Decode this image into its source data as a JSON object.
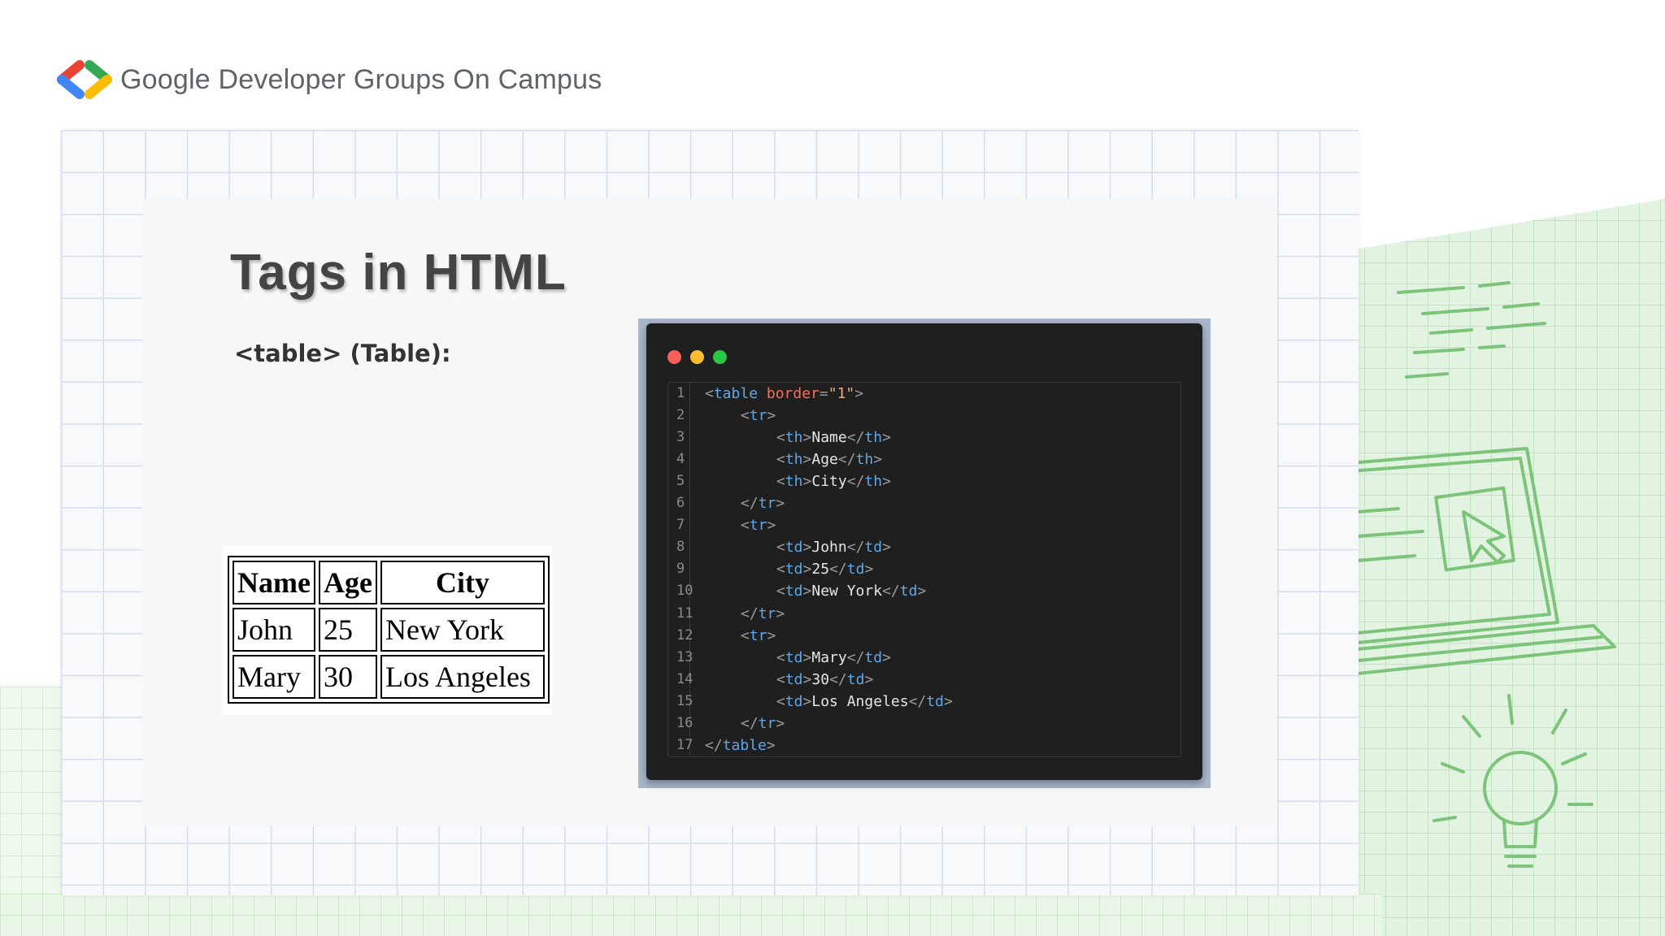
{
  "header": {
    "brand_text": "Google Developer Groups On Campus",
    "logo_colors": [
      "#ea4335",
      "#4285f4",
      "#34a853",
      "#fbbc04"
    ]
  },
  "slide": {
    "title": "Tags in HTML",
    "subtitle": "<table> (Table):"
  },
  "rendered_table": {
    "headers": [
      "Name",
      "Age",
      "City"
    ],
    "rows": [
      [
        "John",
        "25",
        "New York"
      ],
      [
        "Mary",
        "30",
        "Los Angeles"
      ]
    ]
  },
  "code_editor": {
    "window_dots": [
      "#ff5f57",
      "#febc2e",
      "#28c840"
    ],
    "lines": [
      {
        "n": "1",
        "indent": 0,
        "tokens": [
          [
            "p",
            "<"
          ],
          [
            "t",
            "table"
          ],
          [
            "s",
            " "
          ],
          [
            "a",
            "border"
          ],
          [
            "p",
            "="
          ],
          [
            "v",
            "\"1\""
          ],
          [
            "p",
            ">"
          ]
        ]
      },
      {
        "n": "2",
        "indent": 1,
        "tokens": [
          [
            "p",
            "<"
          ],
          [
            "t",
            "tr"
          ],
          [
            "p",
            ">"
          ]
        ]
      },
      {
        "n": "3",
        "indent": 2,
        "tokens": [
          [
            "p",
            "<"
          ],
          [
            "t",
            "th"
          ],
          [
            "p",
            ">"
          ],
          [
            "x",
            "Name"
          ],
          [
            "p",
            "</"
          ],
          [
            "t",
            "th"
          ],
          [
            "p",
            ">"
          ]
        ]
      },
      {
        "n": "4",
        "indent": 2,
        "tokens": [
          [
            "p",
            "<"
          ],
          [
            "t",
            "th"
          ],
          [
            "p",
            ">"
          ],
          [
            "x",
            "Age"
          ],
          [
            "p",
            "</"
          ],
          [
            "t",
            "th"
          ],
          [
            "p",
            ">"
          ]
        ]
      },
      {
        "n": "5",
        "indent": 2,
        "tokens": [
          [
            "p",
            "<"
          ],
          [
            "t",
            "th"
          ],
          [
            "p",
            ">"
          ],
          [
            "x",
            "City"
          ],
          [
            "p",
            "</"
          ],
          [
            "t",
            "th"
          ],
          [
            "p",
            ">"
          ]
        ]
      },
      {
        "n": "6",
        "indent": 1,
        "tokens": [
          [
            "p",
            "</"
          ],
          [
            "t",
            "tr"
          ],
          [
            "p",
            ">"
          ]
        ]
      },
      {
        "n": "7",
        "indent": 1,
        "tokens": [
          [
            "p",
            "<"
          ],
          [
            "t",
            "tr"
          ],
          [
            "p",
            ">"
          ]
        ]
      },
      {
        "n": "8",
        "indent": 2,
        "tokens": [
          [
            "p",
            "<"
          ],
          [
            "t",
            "td"
          ],
          [
            "p",
            ">"
          ],
          [
            "x",
            "John"
          ],
          [
            "p",
            "</"
          ],
          [
            "t",
            "td"
          ],
          [
            "p",
            ">"
          ]
        ]
      },
      {
        "n": "9",
        "indent": 2,
        "tokens": [
          [
            "p",
            "<"
          ],
          [
            "t",
            "td"
          ],
          [
            "p",
            ">"
          ],
          [
            "x",
            "25"
          ],
          [
            "p",
            "</"
          ],
          [
            "t",
            "td"
          ],
          [
            "p",
            ">"
          ]
        ]
      },
      {
        "n": "10",
        "indent": 2,
        "tokens": [
          [
            "p",
            "<"
          ],
          [
            "t",
            "td"
          ],
          [
            "p",
            ">"
          ],
          [
            "x",
            "New York"
          ],
          [
            "p",
            "</"
          ],
          [
            "t",
            "td"
          ],
          [
            "p",
            ">"
          ]
        ]
      },
      {
        "n": "11",
        "indent": 1,
        "tokens": [
          [
            "p",
            "</"
          ],
          [
            "t",
            "tr"
          ],
          [
            "p",
            ">"
          ]
        ]
      },
      {
        "n": "12",
        "indent": 1,
        "tokens": [
          [
            "p",
            "<"
          ],
          [
            "t",
            "tr"
          ],
          [
            "p",
            ">"
          ]
        ]
      },
      {
        "n": "13",
        "indent": 2,
        "tokens": [
          [
            "p",
            "<"
          ],
          [
            "t",
            "td"
          ],
          [
            "p",
            ">"
          ],
          [
            "x",
            "Mary"
          ],
          [
            "p",
            "</"
          ],
          [
            "t",
            "td"
          ],
          [
            "p",
            ">"
          ]
        ]
      },
      {
        "n": "14",
        "indent": 2,
        "tokens": [
          [
            "p",
            "<"
          ],
          [
            "t",
            "td"
          ],
          [
            "p",
            ">"
          ],
          [
            "x",
            "30"
          ],
          [
            "p",
            "</"
          ],
          [
            "t",
            "td"
          ],
          [
            "p",
            ">"
          ]
        ]
      },
      {
        "n": "15",
        "indent": 2,
        "tokens": [
          [
            "p",
            "<"
          ],
          [
            "t",
            "td"
          ],
          [
            "p",
            ">"
          ],
          [
            "x",
            "Los Angeles"
          ],
          [
            "p",
            "</"
          ],
          [
            "t",
            "td"
          ],
          [
            "p",
            ">"
          ]
        ]
      },
      {
        "n": "16",
        "indent": 1,
        "tokens": [
          [
            "p",
            "</"
          ],
          [
            "t",
            "tr"
          ],
          [
            "p",
            ">"
          ]
        ]
      },
      {
        "n": "17",
        "indent": 0,
        "tokens": [
          [
            "p",
            "</"
          ],
          [
            "t",
            "table"
          ],
          [
            "p",
            ">"
          ]
        ]
      }
    ]
  }
}
